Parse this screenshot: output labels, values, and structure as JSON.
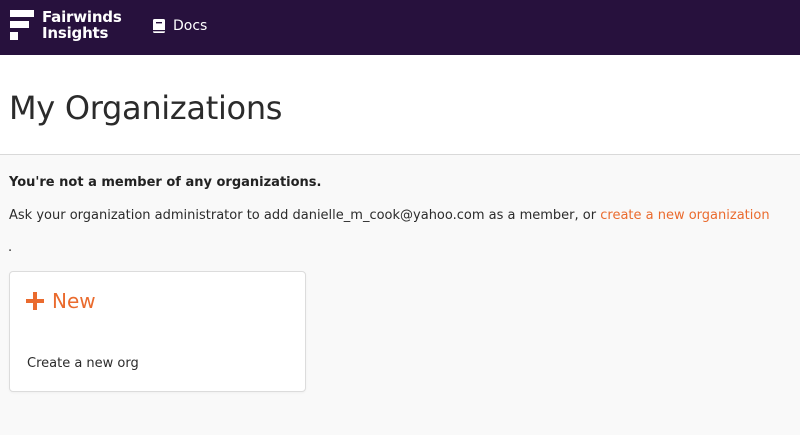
{
  "navbar": {
    "brand_line1": "Fairwinds",
    "brand_line2": "Insights",
    "docs_label": "Docs"
  },
  "header": {
    "title": "My Organizations"
  },
  "main": {
    "not_member_text": "You're not a member of any organizations.",
    "ask_text": "Ask your organization administrator to add danielle_m_cook@yahoo.com as a member, or ",
    "create_link": "create a new organization",
    "period": "."
  },
  "new_card": {
    "label": "New",
    "description": "Create a new org"
  },
  "colors": {
    "navbar_bg": "#27113d",
    "accent": "#ea6b2e"
  },
  "icons": {
    "brand": "fairwinds-logo-icon",
    "docs": "book-icon",
    "new": "plus-icon"
  }
}
